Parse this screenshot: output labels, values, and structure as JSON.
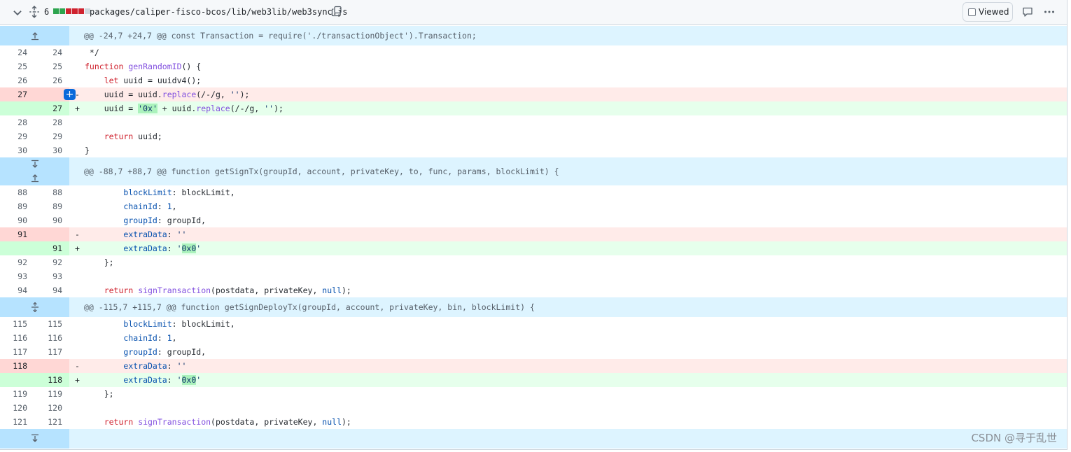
{
  "file": {
    "change_count": "6",
    "diffstat_colors": [
      "#2da44e",
      "#2da44e",
      "#cf222e",
      "#cf222e",
      "#cf222e",
      "#d0d7de"
    ],
    "path": "packages/caliper-fisco-bcos/lib/web3lib/web3sync.js",
    "viewed_label": "Viewed",
    "icons": [
      "chevron-down-icon",
      "unfold-icon",
      "copy-icon",
      "comment-icon",
      "kebab-icon"
    ]
  },
  "hunks": [
    {
      "header": "@@ -24,7 +24,7 @@ const Transaction = require('./transactionObject').Transaction;"
    },
    {
      "header": "@@ -88,7 +88,7 @@ function getSignTx(groupId, account, privateKey, to, func, params, blockLimit) {"
    },
    {
      "header": "@@ -115,7 +115,7 @@ function getSignDeployTx(groupId, account, privateKey, bin, blockLimit) {"
    }
  ],
  "lines": {
    "h1": [
      {
        "old": "24",
        "new": "24",
        "type": "ctx",
        "marker": "",
        "code": " */"
      },
      {
        "old": "25",
        "new": "25",
        "type": "ctx",
        "marker": "",
        "code": "function genRandomID() {"
      },
      {
        "old": "26",
        "new": "26",
        "type": "ctx",
        "marker": "",
        "code": "    let uuid = uuidv4();"
      },
      {
        "old": "27",
        "new": "",
        "type": "del",
        "marker": "-",
        "code": "    uuid = uuid.replace(/-/g, '');"
      },
      {
        "old": "",
        "new": "27",
        "type": "add",
        "marker": "+",
        "code": "    uuid = '0x' + uuid.replace(/-/g, '');"
      },
      {
        "old": "28",
        "new": "28",
        "type": "ctx",
        "marker": "",
        "code": ""
      },
      {
        "old": "29",
        "new": "29",
        "type": "ctx",
        "marker": "",
        "code": "    return uuid;"
      },
      {
        "old": "30",
        "new": "30",
        "type": "ctx",
        "marker": "",
        "code": "}"
      }
    ],
    "h2": [
      {
        "old": "88",
        "new": "88",
        "type": "ctx",
        "marker": "",
        "code": "        blockLimit: blockLimit,"
      },
      {
        "old": "89",
        "new": "89",
        "type": "ctx",
        "marker": "",
        "code": "        chainId: 1,"
      },
      {
        "old": "90",
        "new": "90",
        "type": "ctx",
        "marker": "",
        "code": "        groupId: groupId,"
      },
      {
        "old": "91",
        "new": "",
        "type": "del",
        "marker": "-",
        "code": "        extraData: ''"
      },
      {
        "old": "",
        "new": "91",
        "type": "add",
        "marker": "+",
        "code": "        extraData: '0x0'"
      },
      {
        "old": "92",
        "new": "92",
        "type": "ctx",
        "marker": "",
        "code": "    };"
      },
      {
        "old": "93",
        "new": "93",
        "type": "ctx",
        "marker": "",
        "code": ""
      },
      {
        "old": "94",
        "new": "94",
        "type": "ctx",
        "marker": "",
        "code": "    return signTransaction(postdata, privateKey, null);"
      }
    ],
    "h3": [
      {
        "old": "115",
        "new": "115",
        "type": "ctx",
        "marker": "",
        "code": "        blockLimit: blockLimit,"
      },
      {
        "old": "116",
        "new": "116",
        "type": "ctx",
        "marker": "",
        "code": "        chainId: 1,"
      },
      {
        "old": "117",
        "new": "117",
        "type": "ctx",
        "marker": "",
        "code": "        groupId: groupId,"
      },
      {
        "old": "118",
        "new": "",
        "type": "del",
        "marker": "-",
        "code": "        extraData: ''"
      },
      {
        "old": "",
        "new": "118",
        "type": "add",
        "marker": "+",
        "code": "        extraData: '0x0'"
      },
      {
        "old": "119",
        "new": "119",
        "type": "ctx",
        "marker": "",
        "code": "    };"
      },
      {
        "old": "120",
        "new": "120",
        "type": "ctx",
        "marker": "",
        "code": ""
      },
      {
        "old": "121",
        "new": "121",
        "type": "ctx",
        "marker": "",
        "code": "    return signTransaction(postdata, privateKey, null);"
      }
    ]
  },
  "watermark": "CSDN @寻于乱世"
}
